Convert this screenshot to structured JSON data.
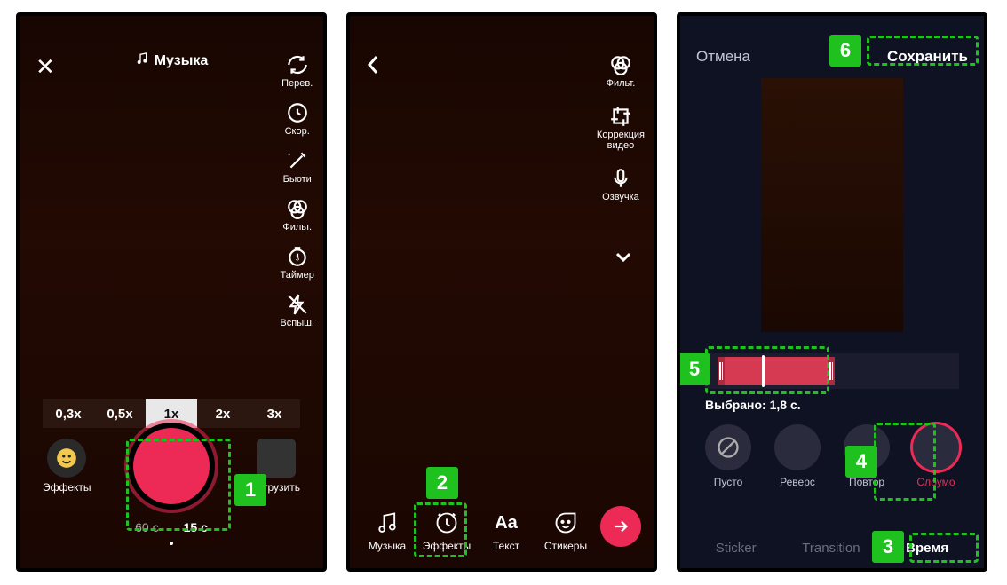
{
  "annotations": {
    "n1": "1",
    "n2": "2",
    "n3": "3",
    "n4": "4",
    "n5": "5",
    "n6": "6"
  },
  "screen1": {
    "music_label": "Музыка",
    "tools": {
      "flip": "Перев.",
      "speed": "Скор.",
      "beauty": "Бьюти",
      "filter": "Фильт.",
      "timer": "Таймер",
      "flash": "Вспыш."
    },
    "speeds": {
      "s03": "0,3x",
      "s05": "0,5x",
      "s1": "1x",
      "s2": "2x",
      "s3": "3x"
    },
    "effects_label": "Эффекты",
    "upload_label": "Загрузить",
    "dur60": "60 с",
    "dur15": "15 с"
  },
  "screen2": {
    "tools": {
      "filter": "Фильт.",
      "adjust": "Коррекция\nвидео",
      "voice": "Озвучка"
    },
    "bottom": {
      "music": "Музыка",
      "effects": "Эффекты",
      "text": "Текст",
      "stickers": "Стикеры"
    }
  },
  "screen3": {
    "cancel": "Отмена",
    "save": "Сохранить",
    "selected": "Выбрано: 1,8 с.",
    "modes": {
      "none": "Пусто",
      "reverse": "Реверс",
      "repeat": "Повтор",
      "slomo": "Слоумо"
    },
    "tabs": {
      "sticker": "Sticker",
      "transition": "Transition",
      "time": "Время"
    }
  }
}
